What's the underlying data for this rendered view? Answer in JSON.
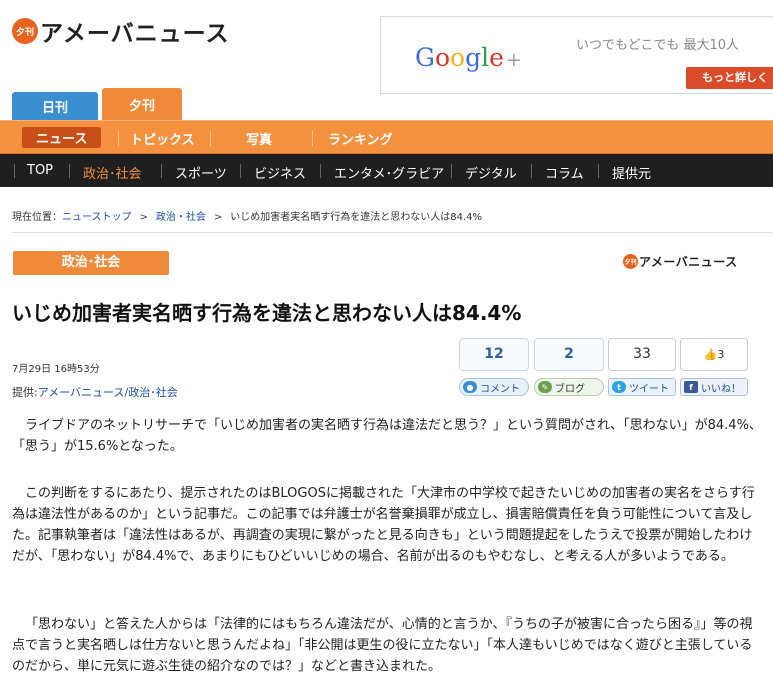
{
  "brand": {
    "badge": "夕刊",
    "name": "アメーバニュース"
  },
  "ad": {
    "google_letters": [
      "G",
      "o",
      "o",
      "g",
      "l",
      "e"
    ],
    "plus": "+",
    "text": "いつでもどこでも 最大10人",
    "button": "もっと詳しく"
  },
  "editions": [
    "日刊",
    "夕刊"
  ],
  "nav_primary": [
    "ニュース",
    "トピックス",
    "写真",
    "ランキング"
  ],
  "nav_secondary": [
    "TOP",
    "政治･社会",
    "スポーツ",
    "ビジネス",
    "エンタメ･グラビア",
    "デジタル",
    "コラム",
    "提供元"
  ],
  "breadcrumb": {
    "prefix": "現在位置：",
    "items": [
      "ニューストップ",
      "政治・社会"
    ],
    "separator": ">",
    "current": "いじめ加害者実名晒す行為を違法と思わない人は84.4%"
  },
  "article": {
    "category": "政治･社会",
    "title": "いじめ加害者実名晒す行為を違法と思わない人は84.4%",
    "date": "7月29日 16時53分",
    "source_label": "提供:",
    "source_link": "アメーバニュース/政治･社会",
    "paragraphs": [
      "ライブドアのネットリサーチで「いじめ加害者の実名晒す行為は違法だと思う？」という質問がされ、「思わない」が84.4%、「思う」が15.6%となった。",
      "この判断をするにあたり、提示されたのはBLOGOSに掲載された「大津市の中学校で起きたいじめの加害者の実名をさらす行為は違法性があるのか」という記事だ。この記事では弁護士が名誉棄損罪が成立し、損害賠償責任を負う可能性について言及した。記事執筆者は「違法性はあるが、再調査の実現に繋がったと見る向きも」という問題提起をしたうえで投票が開始したわけだが、「思わない」が84.4%で、あまりにもひどいいじめの場合、名前が出るのもやむなし、と考える人が多いようである。",
      "「思わない」と答えた人からは「法律的にはもちろん違法だが、心情的と言うか、『うちの子が被害に合ったら困る』」等の視点で言うと実名晒しは仕方ないと思うんだよね」「非公開は更生の役に立たない」「本人達もいじめではなく遊びと主張しているのだから、単に元気に遊ぶ生徒の紹介なのでは？」などと書き込まれた。"
    ]
  },
  "social": {
    "comment_count": "12",
    "blog_count": "2",
    "tweet_count": "33",
    "like_count": "3",
    "comment_label": "コメント",
    "blog_label": "ブログ",
    "tweet_label": "ツイート",
    "like_label": "いいね！"
  },
  "colors": {
    "orange": "#f3913f",
    "dark_nav": "#1f1f1f",
    "blue_tab": "#3a8fd1",
    "link": "#1a4fa0"
  }
}
